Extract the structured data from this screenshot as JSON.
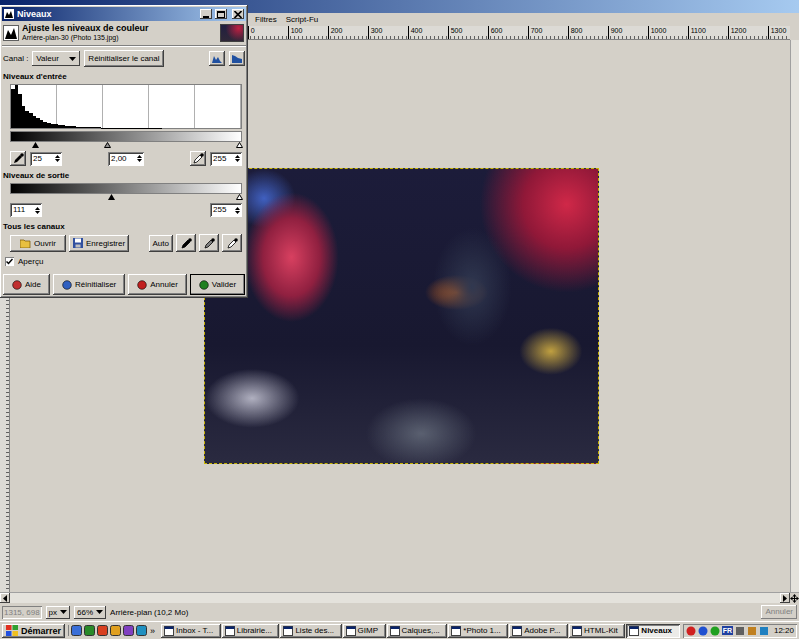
{
  "image_window": {
    "menu": [
      "Filtres",
      "Script-Fu"
    ],
    "ruler_labels": [
      "0",
      "100",
      "200",
      "300",
      "400",
      "500",
      "600",
      "700",
      "800",
      "900",
      "1000",
      "1100",
      "1200",
      "1300"
    ],
    "status_bar": {
      "coords": "1315, 698",
      "coords_disabled": true,
      "unit": "px",
      "zoom": "66%",
      "layer_info": "Arrière-plan (10,2 Mo)",
      "cancel": "Annuler",
      "cancel_disabled": true
    }
  },
  "dialog": {
    "title": "Niveaux",
    "heading": "Ajuste les niveaux de couleur",
    "subheading": "Arrière-plan-30 (Photo 135.jpg)",
    "channel_label": "Canal :",
    "channel": "Valeur",
    "reset_channel": "Réinitialiser le canal",
    "input": {
      "label": "Niveaux d'entrée",
      "histogram": [
        0.9,
        1.0,
        0.78,
        0.52,
        0.4,
        0.34,
        0.29,
        0.24,
        0.19,
        0.15,
        0.12,
        0.1,
        0.085,
        0.07,
        0.06,
        0.05,
        0.042,
        0.036,
        0.03,
        0.026,
        0.022,
        0.019,
        0.016,
        0.014,
        0.012,
        0.01,
        0.009,
        0.008,
        0.007,
        0.006,
        0.005,
        0.005,
        0.004,
        0.004,
        0.003,
        0.003,
        0.003,
        0.002,
        0.002,
        0.002,
        0.002,
        0.002,
        0.001,
        0.001,
        0.001,
        0.001,
        0.001,
        0.001,
        0.001,
        0.001,
        0.001,
        0.001,
        0.001,
        0.001,
        0.001,
        0.001,
        0.001,
        0.001,
        0.001,
        0.001,
        0.001,
        0.001,
        0.001,
        0.001
      ],
      "black": "25",
      "gamma": "2,00",
      "white": "255",
      "black_level": 0.098,
      "gamma_level": 0.418,
      "white_level": 1.0
    },
    "output": {
      "label": "Niveaux de sortie",
      "black": "111",
      "white": "255",
      "black_level": 0.435,
      "white_level": 1.0
    },
    "all_channels": {
      "label": "Tous les canaux",
      "open": "Ouvrir",
      "save": "Enregistrer",
      "auto": "Auto"
    },
    "preview": {
      "label": "Aperçu",
      "checked": true
    },
    "buttons": [
      "Aide",
      "Réinitialiser",
      "Annuler",
      "Valider"
    ]
  },
  "taskbar": {
    "start": "Démarrer",
    "overflow": "»",
    "tasks": [
      {
        "label": "Inbox - T...",
        "selected": false
      },
      {
        "label": "Librairie...",
        "selected": false
      },
      {
        "label": "Liste des...",
        "selected": false
      },
      {
        "label": "GIMP",
        "selected": false
      },
      {
        "label": "Calques,...",
        "selected": false
      },
      {
        "label": "*Photo 1...",
        "selected": false
      },
      {
        "label": "Adobe P...",
        "selected": false
      },
      {
        "label": "HTML-Kit",
        "selected": false
      },
      {
        "label": "Niveaux",
        "selected": true
      }
    ],
    "language": "FR",
    "clock": "12:20"
  }
}
